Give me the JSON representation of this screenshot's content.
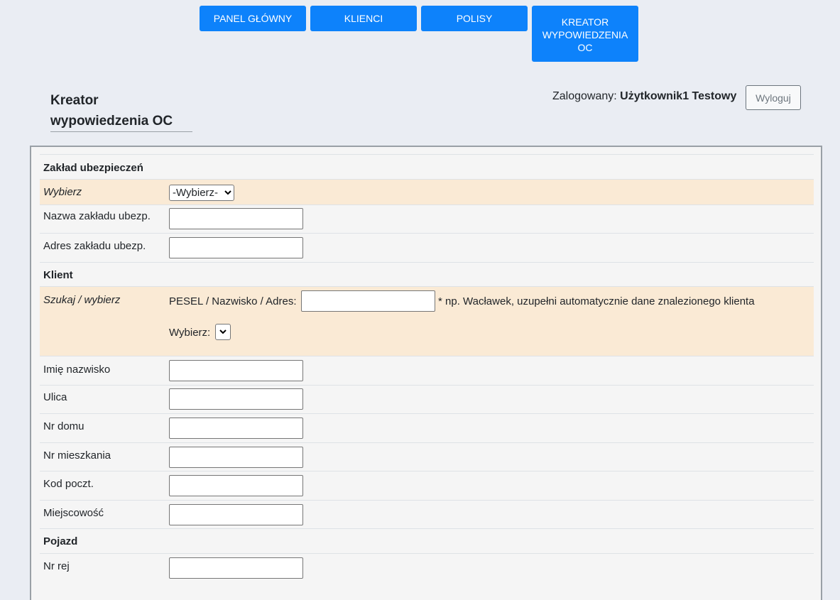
{
  "nav": {
    "items": [
      {
        "label": "PANEL GŁÓWNY"
      },
      {
        "label": "KLIENCI"
      },
      {
        "label": "POLISY"
      },
      {
        "label": "KREATOR WYPOWIEDZENIA OC"
      }
    ]
  },
  "header": {
    "title": "Kreator wypowiedzenia OC",
    "logged_prefix": "Zalogowany: ",
    "user_name": "Użytkownik1 Testowy",
    "logout_label": "Wyloguj"
  },
  "form": {
    "insurer_section": "Zakład ubezpieczeń",
    "insurer_select_label": "Wybierz",
    "insurer_select_value": "-Wybierz-",
    "insurer_name_label": "Nazwa zakładu ubezp.",
    "insurer_name_value": "",
    "insurer_address_label": "Adres zakładu ubezp.",
    "insurer_address_value": "",
    "client_section": "Klient",
    "client_search_label": "Szukaj / wybierz",
    "client_search_prompt": "PESEL / Nazwisko / Adres:",
    "client_search_value": "",
    "client_search_hint": "* np. Wacławek, uzupełni automatycznie dane znalezionego klienta",
    "client_pick_label": "Wybierz:",
    "client_pick_value": "",
    "name_label": "Imię nazwisko",
    "name_value": "",
    "street_label": "Ulica",
    "street_value": "",
    "house_no_label": "Nr domu",
    "house_no_value": "",
    "flat_no_label": "Nr mieszkania",
    "flat_no_value": "",
    "postcode_label": "Kod poczt.",
    "postcode_value": "",
    "city_label": "Miejscowość",
    "city_value": "",
    "vehicle_section": "Pojazd",
    "reg_no_label": "Nr rej",
    "reg_no_value": ""
  },
  "colors": {
    "accent": "#0d82fb",
    "page_bg": "#eaedf3",
    "highlight_row": "#faead5"
  }
}
